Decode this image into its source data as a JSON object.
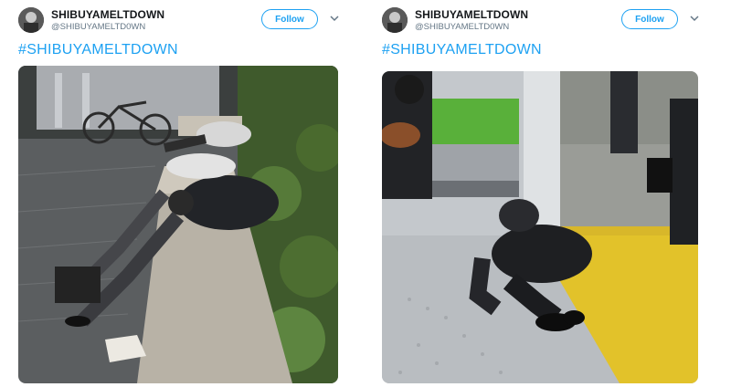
{
  "tweets": [
    {
      "username": "SHIBUYAMELTDOWN",
      "handle": "@SHIBUYAMELTD0WN",
      "follow_label": "Follow",
      "hashtag": "#SHIBUYAMELTDOWN",
      "image": "man-sleeping-on-ledge-photo"
    },
    {
      "username": "SHIBUYAMELTDOWN",
      "handle": "@SHIBUYAMELTD0WN",
      "follow_label": "Follow",
      "hashtag": "#SHIBUYAMELTDOWN",
      "image": "man-lying-on-train-floor-photo"
    }
  ],
  "colors": {
    "accent": "#1da1f2",
    "text": "#14171a",
    "muted": "#657786"
  },
  "icons": {
    "menu": "chevron-down-icon",
    "avatar": "avatar"
  }
}
